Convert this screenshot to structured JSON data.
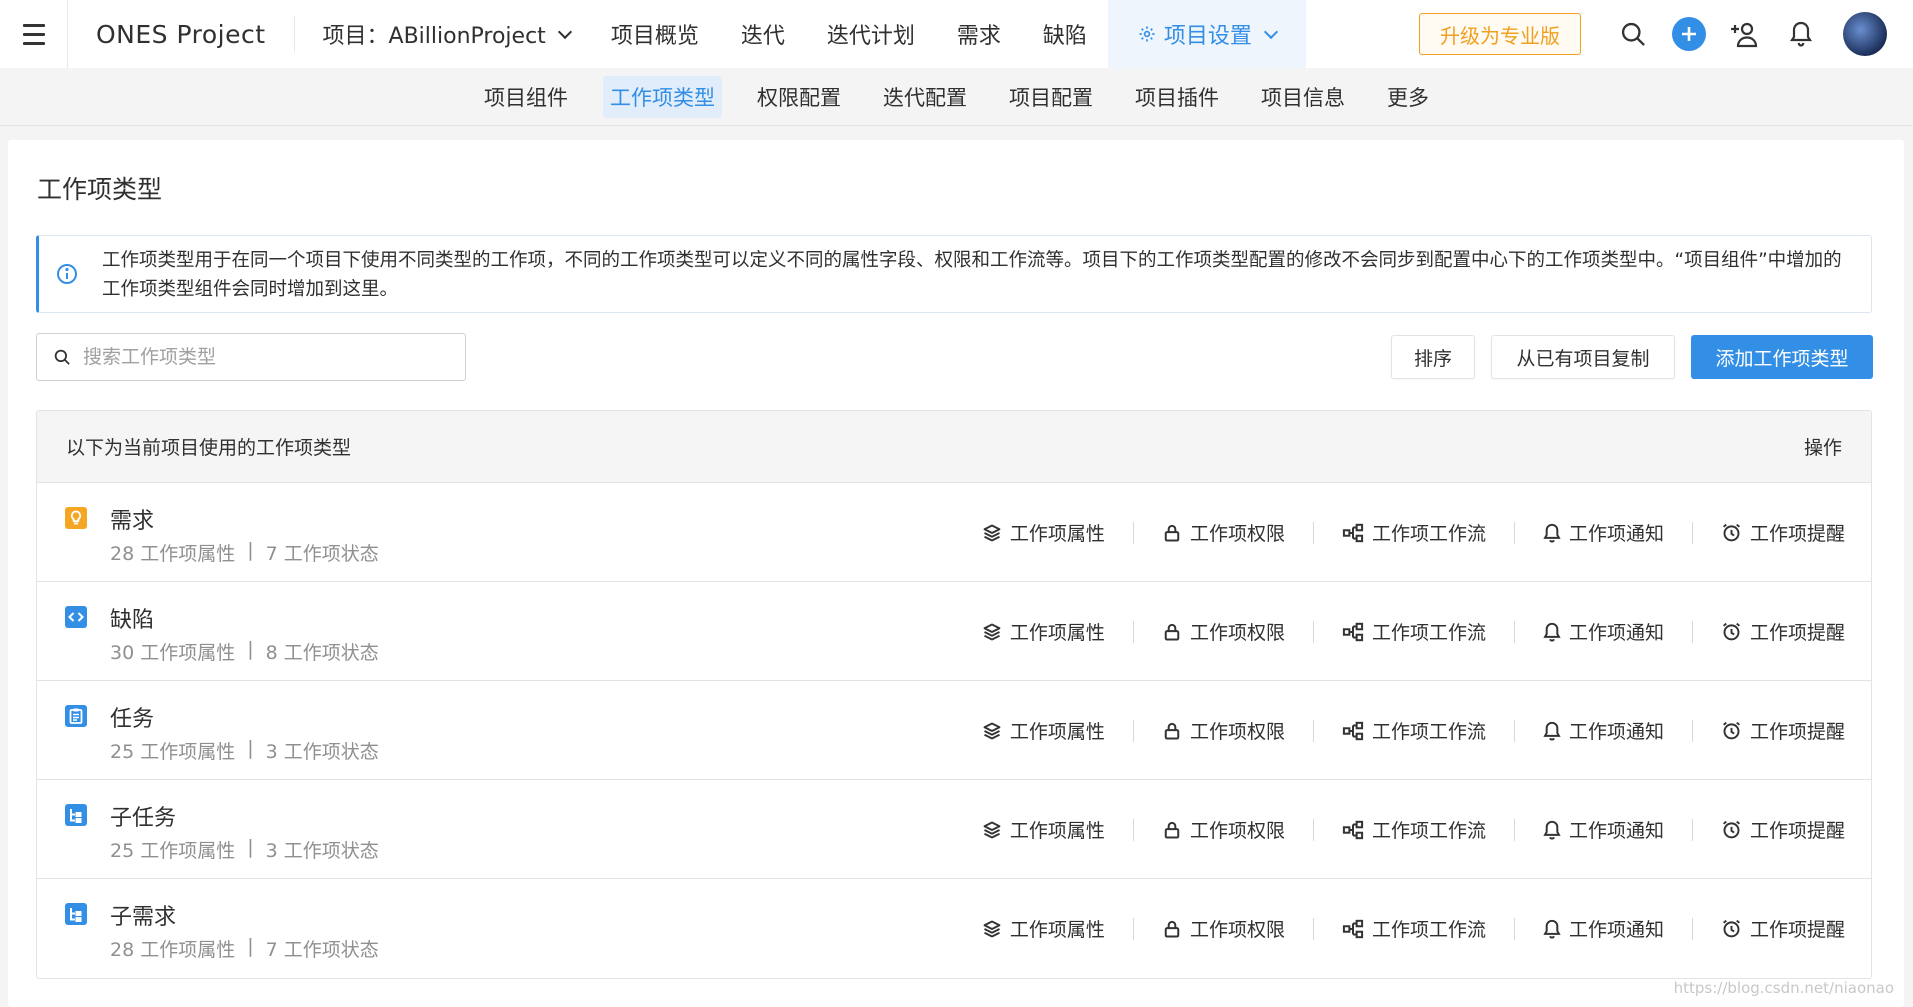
{
  "header": {
    "brand": "ONES Project",
    "project_selector": "项目：ABillionProject",
    "nav": [
      "项目概览",
      "迭代",
      "迭代计划",
      "需求",
      "缺陷"
    ],
    "active_nav": "项目设置",
    "upgrade": "升级为专业版"
  },
  "subnav": {
    "items": [
      "项目组件",
      "工作项类型",
      "权限配置",
      "迭代配置",
      "项目配置",
      "项目插件",
      "项目信息",
      "更多"
    ],
    "active_index": 1
  },
  "page": {
    "title": "工作项类型",
    "info": "工作项类型用于在同一个项目下使用不同类型的工作项，不同的工作项类型可以定义不同的属性字段、权限和工作流等。项目下的工作项类型配置的修改不会同步到配置中心下的工作项类型中。“项目组件”中增加的工作项类型组件会同时增加到这里。",
    "search_placeholder": "搜索工作项类型",
    "btn_sort": "排序",
    "btn_copy": "从已有项目复制",
    "btn_add": "添加工作项类型"
  },
  "table": {
    "header_left": "以下为当前项目使用的工作项类型",
    "header_right": "操作",
    "actions": [
      "工作项属性",
      "工作项权限",
      "工作项工作流",
      "工作项通知",
      "工作项提醒"
    ],
    "rows": [
      {
        "name": "需求",
        "attrs": "28 工作项属性",
        "states": "7 工作项状态",
        "icon": "lightbulb-icon",
        "color": "#f5a623"
      },
      {
        "name": "缺陷",
        "attrs": "30 工作项属性",
        "states": "8 工作项状态",
        "icon": "code-icon",
        "color": "#338fe5"
      },
      {
        "name": "任务",
        "attrs": "25 工作项属性",
        "states": "3 工作项状态",
        "icon": "clipboard-icon",
        "color": "#338fe5"
      },
      {
        "name": "子任务",
        "attrs": "25 工作项属性",
        "states": "3 工作项状态",
        "icon": "subtask-icon",
        "color": "#338fe5"
      },
      {
        "name": "子需求",
        "attrs": "28 工作项属性",
        "states": "7 工作项状态",
        "icon": "subtask-icon",
        "color": "#338fe5"
      }
    ],
    "separator": "|"
  },
  "watermark": "https://blog.csdn.net/niaonao"
}
